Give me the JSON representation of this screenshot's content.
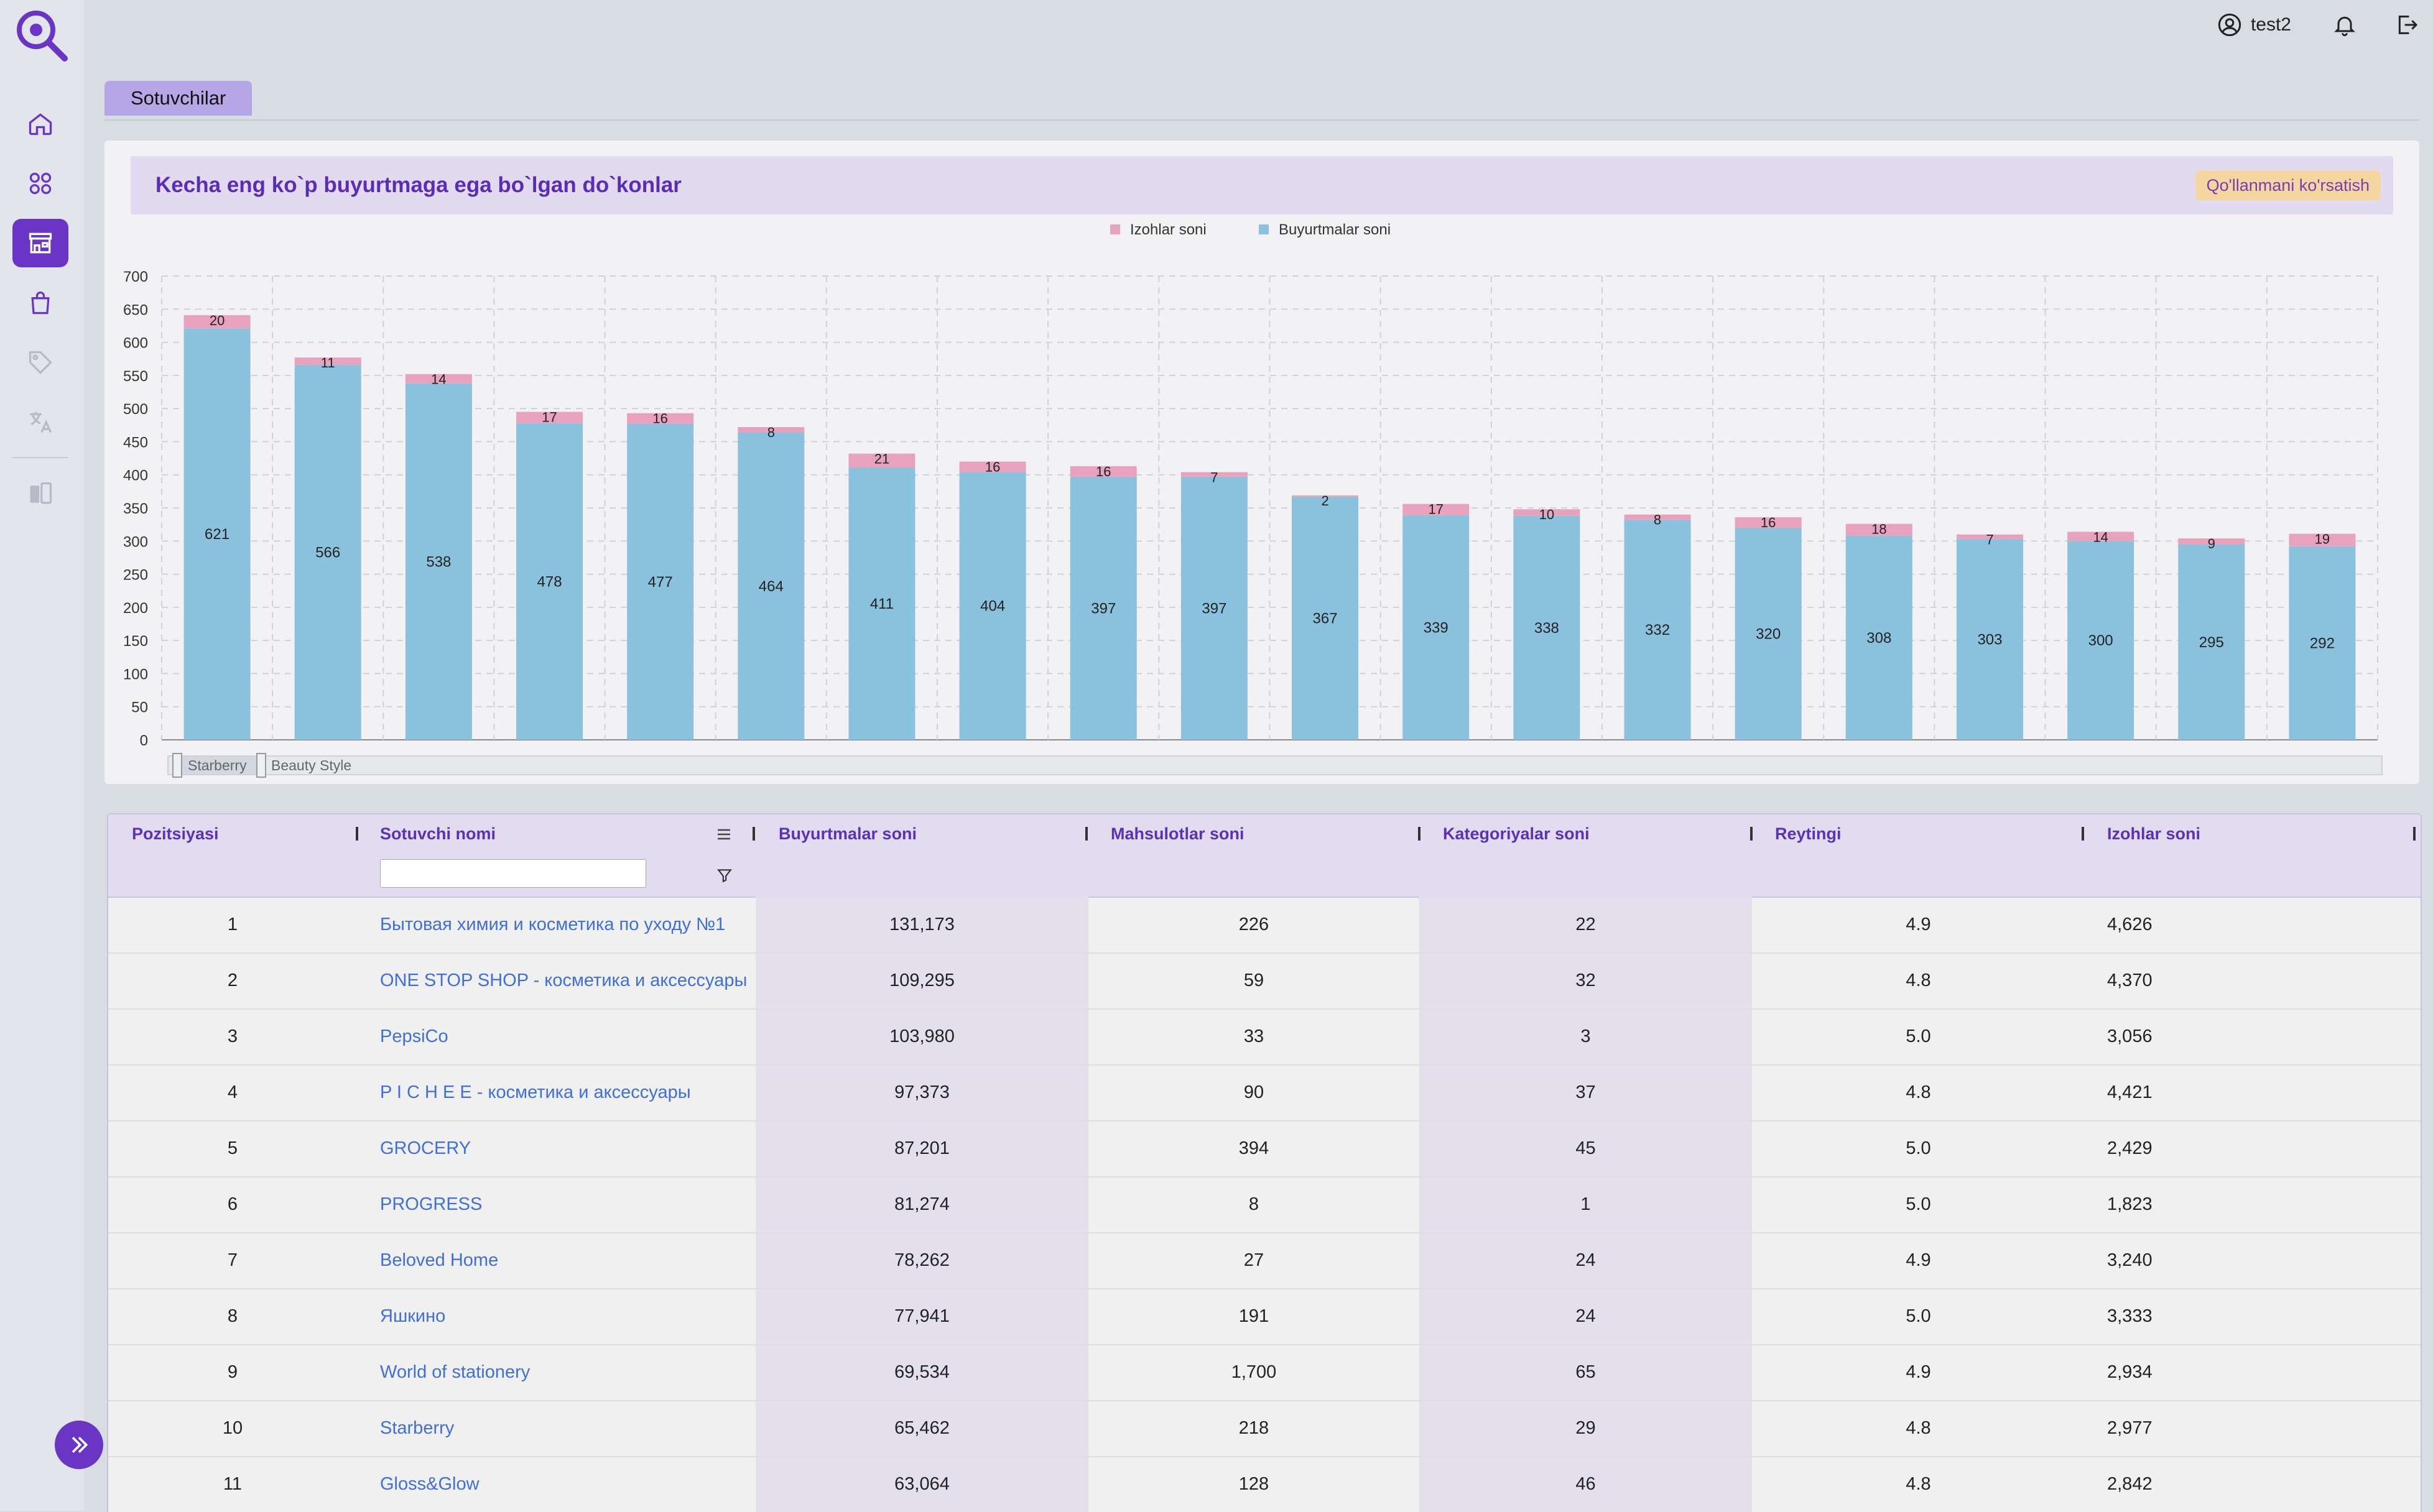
{
  "app": {
    "username": "test2",
    "active_tab": "Sotuvchilar"
  },
  "sidebar": {
    "items": [
      {
        "icon": "home-icon"
      },
      {
        "icon": "grid-icon"
      },
      {
        "icon": "store-icon"
      },
      {
        "icon": "shopping-bag-icon"
      },
      {
        "icon": "tag-icon"
      },
      {
        "icon": "translate-icon"
      },
      {
        "icon": "compare-icon"
      }
    ],
    "active": "store-icon"
  },
  "chart_card": {
    "title": "Kecha eng ko`p buyurtmaga ega bo`lgan do`konlar",
    "guide_button": "Qo'llanmani ko'rsatish"
  },
  "chart_data": {
    "type": "bar",
    "stacked": true,
    "ylim": [
      0,
      700
    ],
    "yticks": [
      0,
      50,
      100,
      150,
      200,
      250,
      300,
      350,
      400,
      450,
      500,
      550,
      600,
      650,
      700
    ],
    "grid": true,
    "legend_position": "top-center",
    "categories": [
      "",
      "",
      "",
      "",
      "",
      "",
      "",
      "",
      "",
      "",
      "",
      "",
      "",
      "",
      "",
      "",
      "",
      "",
      "",
      ""
    ],
    "series": [
      {
        "name": "Buyurtmalar soni",
        "color": "#8ac2dd",
        "values": [
          621,
          566,
          538,
          478,
          477,
          464,
          411,
          404,
          397,
          397,
          367,
          339,
          338,
          332,
          320,
          308,
          303,
          300,
          295,
          292
        ]
      },
      {
        "name": "Izohlar soni",
        "color": "#e8a2be",
        "values": [
          20,
          11,
          14,
          17,
          16,
          8,
          21,
          16,
          16,
          7,
          2,
          17,
          10,
          8,
          16,
          18,
          7,
          14,
          9,
          19
        ]
      }
    ],
    "zoom_slider_labels": {
      "start": "Starberry",
      "end": "Beauty Style"
    }
  },
  "table": {
    "columns": [
      "Pozitsiyasi",
      "Sotuvchi nomi",
      "Buyurtmalar soni",
      "Mahsulotlar soni",
      "Kategoriyalar soni",
      "Reytingi",
      "Izohlar soni"
    ],
    "rows": [
      [
        "1",
        "Бытовая химия и косметика по уходу №1",
        "131,173",
        "226",
        "22",
        "4.9",
        "4,626"
      ],
      [
        "2",
        "ONE STOP SHOP - косметика и аксессуары",
        "109,295",
        "59",
        "32",
        "4.8",
        "4,370"
      ],
      [
        "3",
        "PepsiCo",
        "103,980",
        "33",
        "3",
        "5.0",
        "3,056"
      ],
      [
        "4",
        "P I C H E E - косметика и аксессуары",
        "97,373",
        "90",
        "37",
        "4.8",
        "4,421"
      ],
      [
        "5",
        "GROCERY",
        "87,201",
        "394",
        "45",
        "5.0",
        "2,429"
      ],
      [
        "6",
        "PROGRESS",
        "81,274",
        "8",
        "1",
        "5.0",
        "1,823"
      ],
      [
        "7",
        "Beloved Home",
        "78,262",
        "27",
        "24",
        "4.9",
        "3,240"
      ],
      [
        "8",
        "Яшкино",
        "77,941",
        "191",
        "24",
        "5.0",
        "3,333"
      ],
      [
        "9",
        "World of stationery",
        "69,534",
        "1,700",
        "65",
        "4.9",
        "2,934"
      ],
      [
        "10",
        "Starberry",
        "65,462",
        "218",
        "29",
        "4.8",
        "2,977"
      ],
      [
        "11",
        "Gloss&Glow",
        "63,064",
        "128",
        "46",
        "4.8",
        "2,842"
      ]
    ]
  }
}
